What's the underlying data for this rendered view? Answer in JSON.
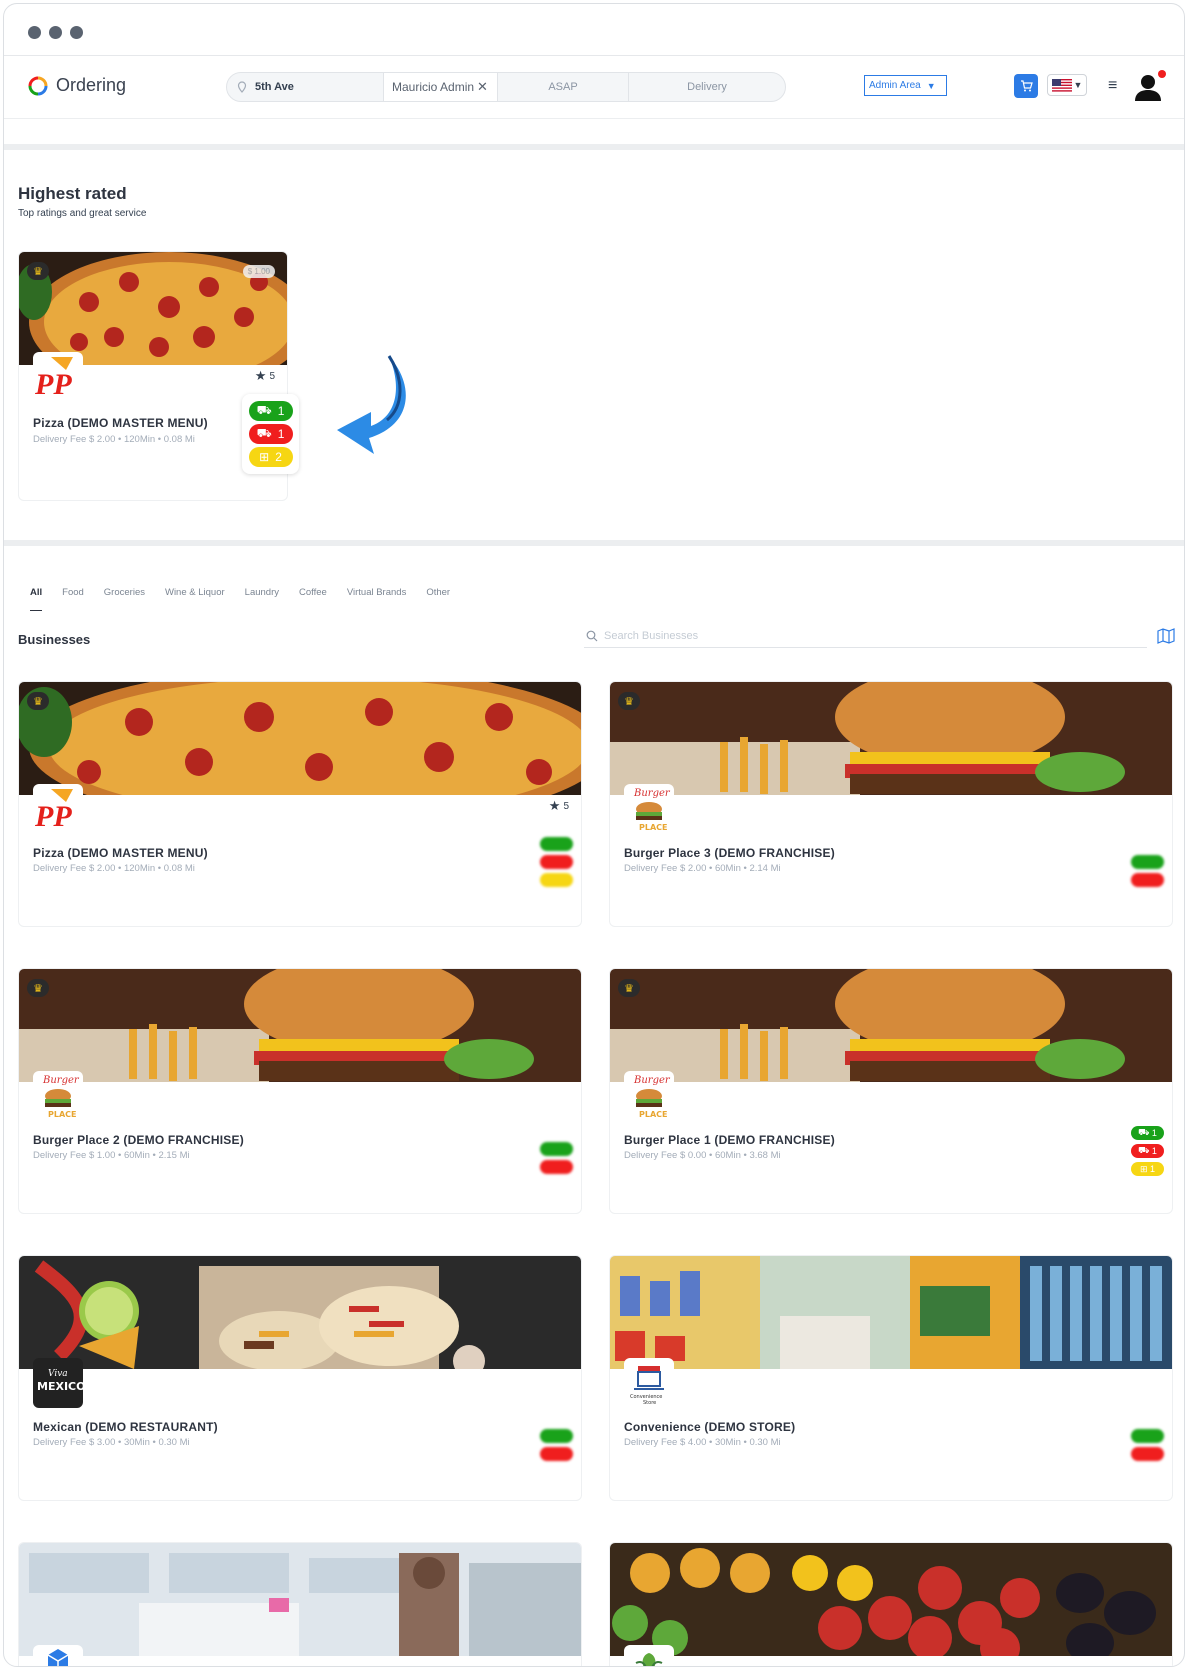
{
  "header": {
    "app_name": "Ordering",
    "address": "5th Ave",
    "user_chip": "Mauricio Admin",
    "time": "ASAP",
    "order_type": "Delivery",
    "admin_area": "Admin Area"
  },
  "highest_rated": {
    "title": "Highest rated",
    "subtitle": "Top ratings and great service",
    "card": {
      "price_chip": "$ 1.00",
      "rating": "5",
      "name": "Pizza (DEMO MASTER MENU)",
      "meta": "Delivery Fee  $ 2.00 • 120Min • 0.08 Mi",
      "badges": [
        "1",
        "1",
        "2"
      ]
    }
  },
  "tabs": [
    "All",
    "Food",
    "Groceries",
    "Wine & Liquor",
    "Laundry",
    "Coffee",
    "Virtual Brands",
    "Other"
  ],
  "businesses": {
    "title": "Businesses",
    "search_placeholder": "Search Businesses",
    "cards": [
      {
        "name": "Pizza (DEMO MASTER MENU)",
        "meta": "Delivery Fee  $ 2.00 • 120Min • 0.08 Mi",
        "rating": "5",
        "logo": "pizza-logo"
      },
      {
        "name": "Burger Place 3 (DEMO FRANCHISE)",
        "meta": "Delivery Fee  $ 2.00 • 60Min • 2.14 Mi",
        "logo": "burger-logo"
      },
      {
        "name": "Burger Place 2 (DEMO FRANCHISE)",
        "meta": "Delivery Fee  $ 1.00 • 60Min • 2.15 Mi",
        "logo": "burger-logo"
      },
      {
        "name": "Burger Place 1 (DEMO FRANCHISE)",
        "meta": "Delivery Fee  $ 0.00 • 60Min • 3.68 Mi",
        "logo": "burger-logo",
        "badges": [
          "1",
          "1",
          "1"
        ]
      },
      {
        "name": "Mexican (DEMO RESTAURANT)",
        "meta": "Delivery Fee  $ 3.00 • 30Min • 0.30 Mi",
        "logo": "mexico-logo"
      },
      {
        "name": "Convenience (DEMO STORE)",
        "meta": "Delivery Fee  $ 4.00 • 30Min • 0.30 Mi",
        "logo": "store-logo"
      }
    ]
  }
}
